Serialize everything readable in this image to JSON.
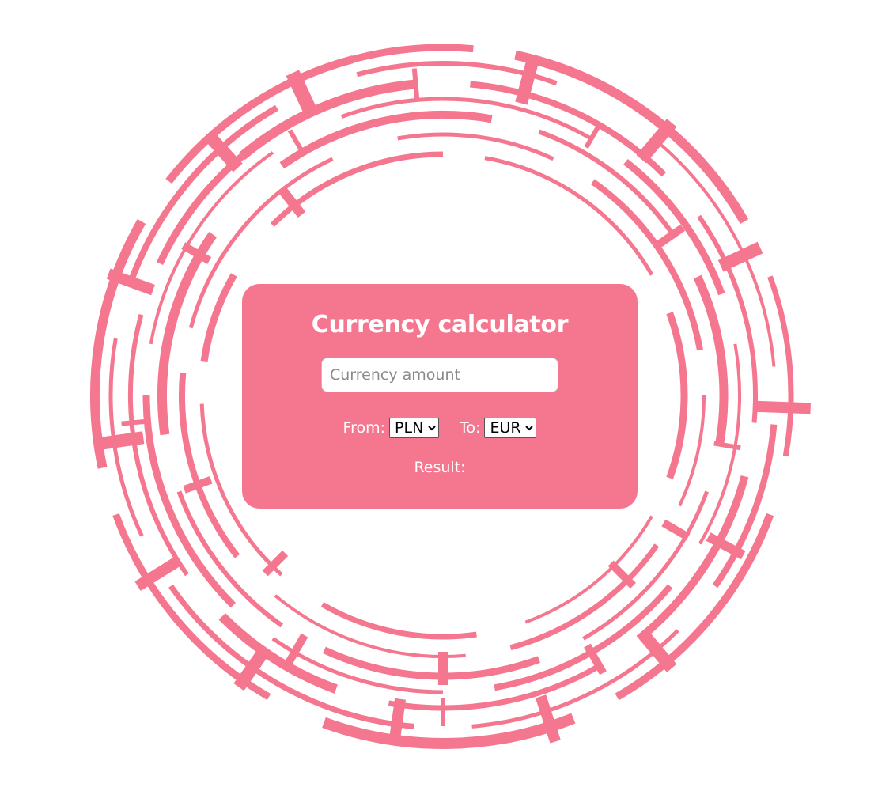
{
  "theme": {
    "accent": "#f5768f",
    "text_on_accent": "#ffffff",
    "background": "#ffffff"
  },
  "calculator": {
    "title": "Currency calculator",
    "amount_placeholder": "Currency amount",
    "amount_value": "",
    "from_label": "From:",
    "from_selected": "PLN",
    "to_label": "To:",
    "to_selected": "EUR",
    "result_label": "Result:",
    "result_value": ""
  },
  "decoration": {
    "name": "concentric-broken-rings",
    "color": "#f5768f"
  }
}
